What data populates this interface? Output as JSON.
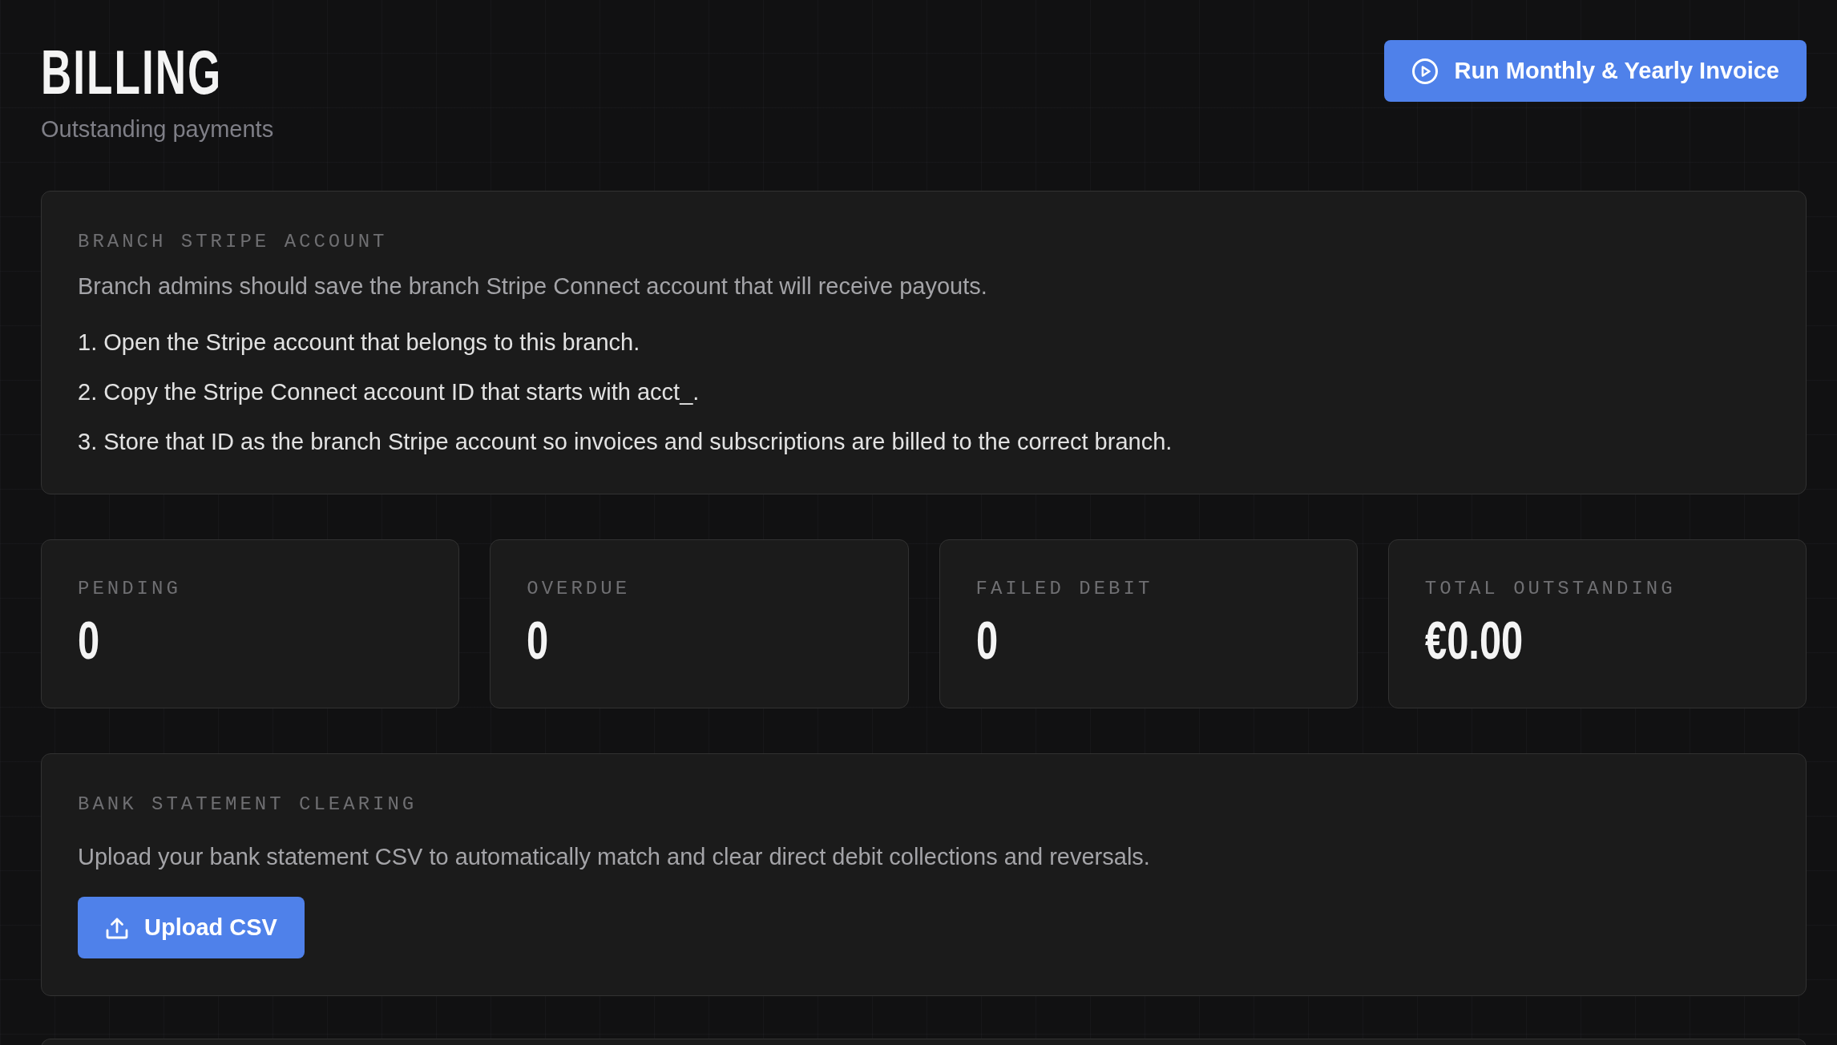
{
  "header": {
    "title": "BILLING",
    "subtitle": "Outstanding payments",
    "action_button": {
      "label": "Run Monthly & Yearly Invoice"
    }
  },
  "stripe_account_card": {
    "heading": "BRANCH STRIPE ACCOUNT",
    "description": "Branch admins should save the branch Stripe Connect account that will receive payouts.",
    "steps": [
      "1. Open the Stripe account that belongs to this branch.",
      "2. Copy the Stripe Connect account ID that starts with acct_.",
      "3. Store that ID as the branch Stripe account so invoices and subscriptions are billed to the correct branch."
    ]
  },
  "stats": [
    {
      "label": "PENDING",
      "value": "0"
    },
    {
      "label": "OVERDUE",
      "value": "0"
    },
    {
      "label": "FAILED DEBIT",
      "value": "0"
    },
    {
      "label": "TOTAL OUTSTANDING",
      "value": "€0.00"
    }
  ],
  "bank_statement_card": {
    "heading": "BANK STATEMENT CLEARING",
    "description": "Upload your bank statement CSV to automatically match and clear direct debit collections and reversals.",
    "button": {
      "label": "Upload CSV"
    }
  }
}
